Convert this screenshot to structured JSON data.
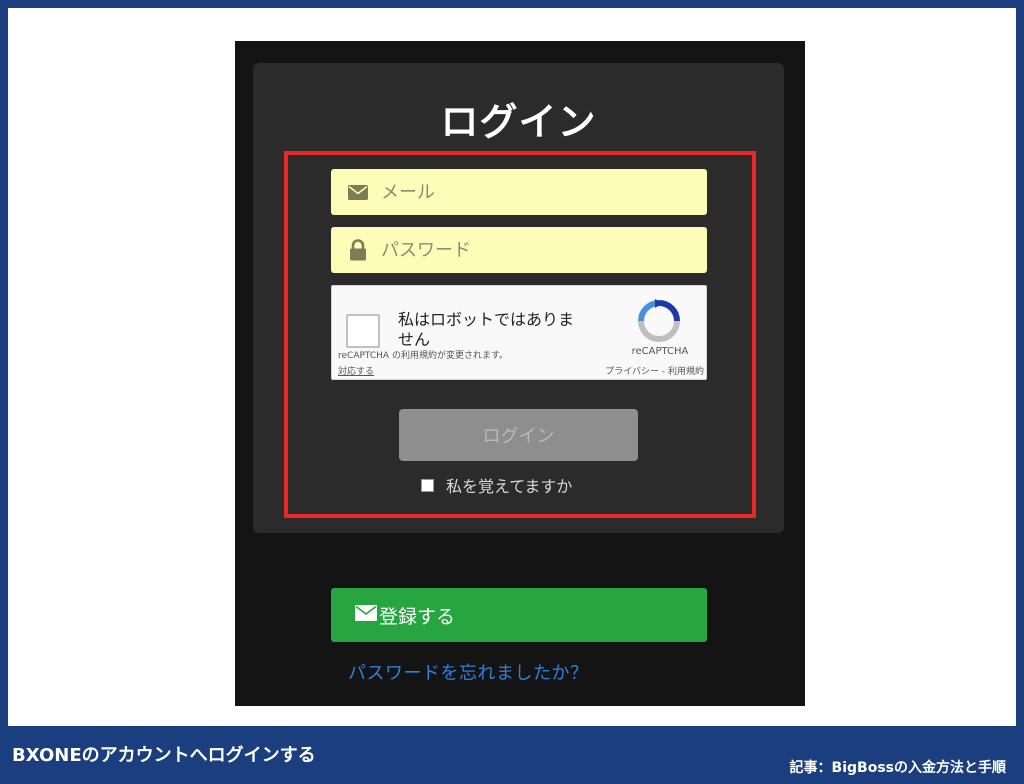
{
  "login": {
    "title": "ログイン",
    "email_placeholder": "メール",
    "password_placeholder": "パスワード",
    "email_icon": "envelope-icon",
    "password_icon": "lock-icon",
    "recaptcha": {
      "label": "私はロボットではありません",
      "brand": "reCAPTCHA",
      "links": "プライバシー - 利用規約",
      "notice": "reCAPTCHA の利用規約が変更されます。",
      "notice_link": "対応する"
    },
    "login_button": "ログイン",
    "remember_label": "私を覚えてますか",
    "register_button": "登録する",
    "forgot_link": "パスワードを忘れましたか？"
  },
  "caption": {
    "left": "BXONEのアカウントへログインする",
    "right": "記事：BigBossの入金方法と手順"
  },
  "colors": {
    "frame": "#1b3f7e",
    "highlight": "#e8262b",
    "field_bg": "#fdfdb7",
    "register": "#27a541",
    "link": "#2f7fdc"
  }
}
